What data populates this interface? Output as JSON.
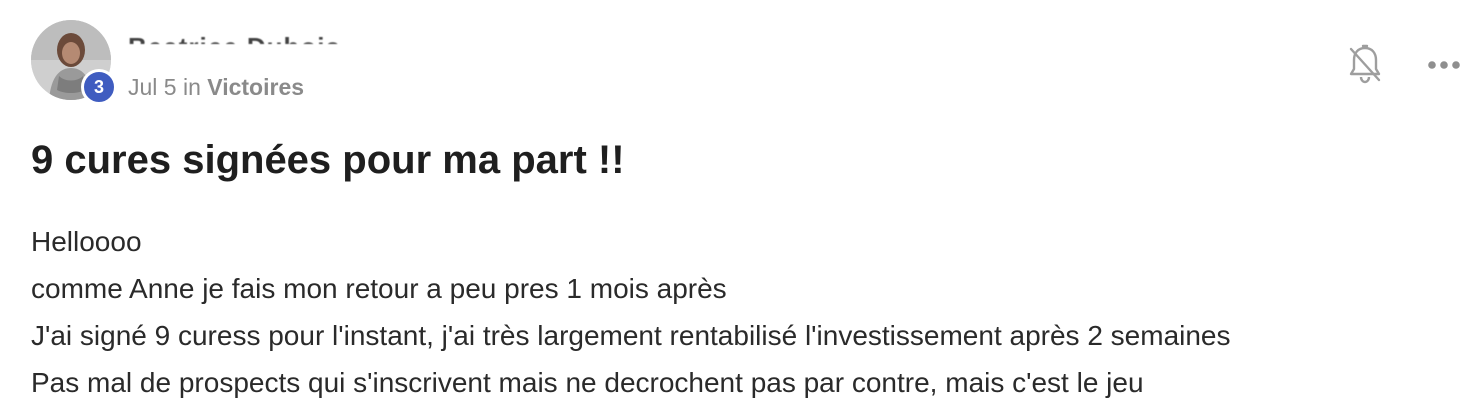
{
  "author": {
    "name": "Beatrice Dubois",
    "level": "3"
  },
  "meta": {
    "date": "Jul 5",
    "in_word": "in",
    "space": "Victoires"
  },
  "icons": {
    "notifications": "bell-off-icon",
    "more": "more-horizontal-icon"
  },
  "post": {
    "title": "9 cures signées pour ma part !!",
    "lines": [
      "Helloooo",
      "comme Anne je fais mon retour a peu pres 1 mois après",
      "J'ai signé 9 curess pour l'instant, j'ai très largement rentabilisé l'investissement après 2 semaines",
      "Pas mal de prospects qui s'inscrivent mais ne decrochent pas par contre, mais c'est le jeu"
    ]
  },
  "colors": {
    "badge": "#3f5cc0",
    "meta_text": "#8a8a8a",
    "title_text": "#1f1f1f"
  }
}
